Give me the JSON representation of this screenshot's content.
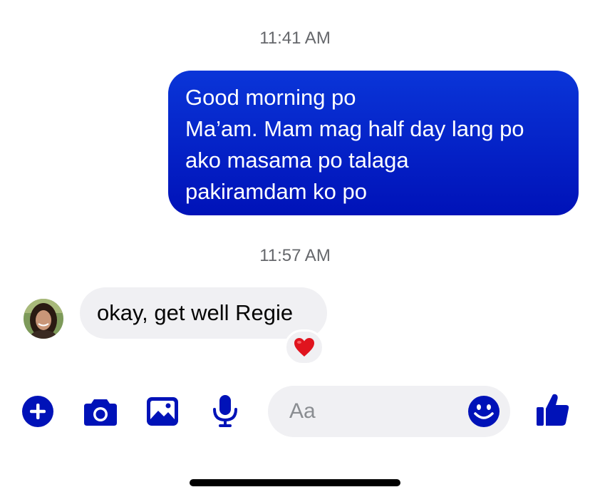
{
  "messages": [
    {
      "timestamp": "11:41 AM",
      "direction": "outgoing",
      "lines": [
        "Good morning po",
        "Ma’am. Mam mag half day lang po",
        "ako masama po talaga",
        "pakiramdam ko po"
      ]
    },
    {
      "timestamp": "11:57 AM",
      "direction": "incoming",
      "text": "okay, get well Regie",
      "reaction": "heart-emoji"
    }
  ],
  "composer": {
    "placeholder": "Aa",
    "icons": [
      "add-icon",
      "camera-icon",
      "gallery-icon",
      "microphone-icon",
      "emoji-icon",
      "thumbs-up-icon"
    ]
  },
  "colors": {
    "accent": "#0012b8",
    "outgoing_bubble_top": "#0a35d8",
    "incoming_bubble": "#f0f0f3",
    "timestamp": "#65676b",
    "reaction": "#e0141e"
  }
}
